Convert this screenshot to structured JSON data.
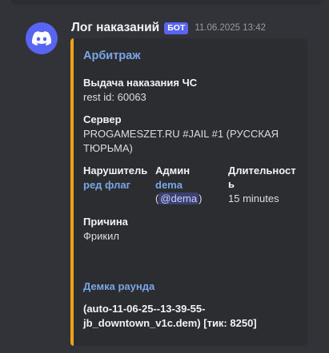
{
  "message": {
    "author": "Лог наказаний",
    "bot_tag": "БОТ",
    "timestamp": "11.06.2025 13:42",
    "avatar_icon": "discord-logo-icon",
    "accent_color": "#f0a21b"
  },
  "embed": {
    "title": "Арбитраж",
    "fields": {
      "action_name": "Выдача наказания ЧС",
      "action_value": "rest id: 60063",
      "server_name": "Сервер",
      "server_value": "PROGAMESZET.RU #JAIL #1 (РУССКАЯ ТЮРЬМА)",
      "violator_name": "Нарушитель",
      "violator_value": "ред флаг",
      "admin_name": "Админ",
      "admin_value": "dema",
      "admin_mention_open": "(",
      "admin_mention": "@dema",
      "admin_mention_close": ")",
      "duration_name": "Длительность",
      "duration_value": "15 minutes",
      "reason_name": "Причина",
      "reason_value": "Фрикил"
    },
    "demo_link": "Демка раунда",
    "demo_file": "(auto-11-06-25--13-39-55-jb_downtown_v1c.dem) [тик: 8250]"
  }
}
